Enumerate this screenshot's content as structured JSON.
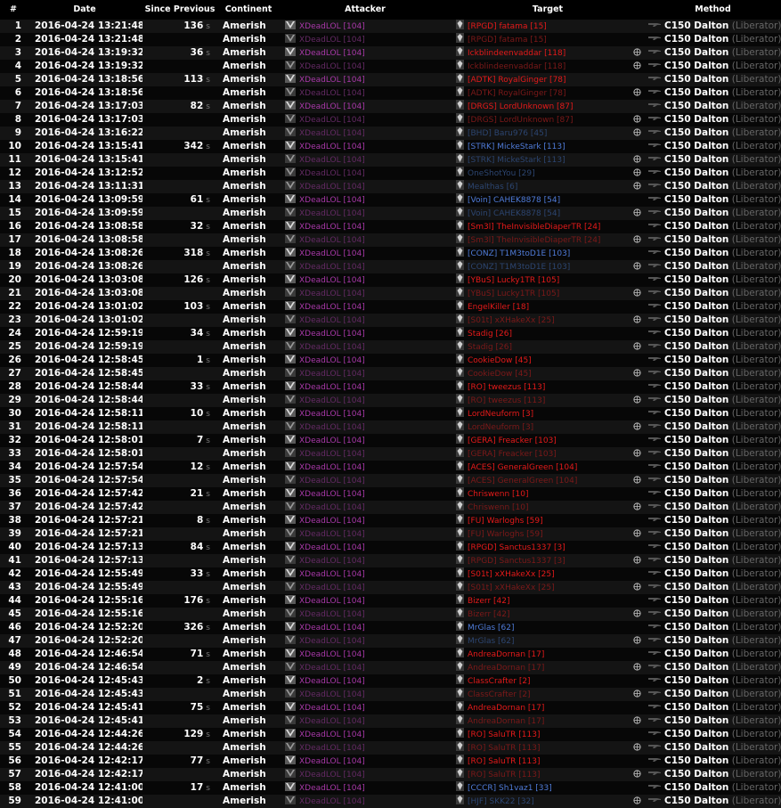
{
  "headers": {
    "num": "#",
    "date": "Date",
    "since": "Since Previous",
    "continent": "Continent",
    "attacker": "Attacker",
    "target": "Target",
    "method": "Method"
  },
  "colors": {
    "attacker_nc": "#a838a8",
    "vs_target": "#e51a1a",
    "nc_target": "#4f7bd8",
    "dim_vs": "#7c1919",
    "dim_nc": "#2c4570"
  },
  "icons": {
    "attacker_emblem": "vs-emblem-icon",
    "target_rank": "rank-icon",
    "headshot": "headshot-icon",
    "weapon": "weapon-icon"
  },
  "rows": [
    {
      "num": "1",
      "date": "2016-04-24 13:21:48",
      "since": "136",
      "continent": "Amerish",
      "attacker": "XDeadLOL [104]",
      "attacker_dim": false,
      "target": "[RPGD] fatama [15]",
      "tcolor": "red",
      "hs": false,
      "method": "C150 Dalton",
      "method_sub": "(Liberator)"
    },
    {
      "num": "2",
      "date": "2016-04-24 13:21:48",
      "since": "",
      "continent": "Amerish",
      "attacker": "XDeadLOL [104]",
      "attacker_dim": true,
      "target": "[RPGD] fatama [15]",
      "tcolor": "dred",
      "hs": false,
      "method": "C150 Dalton",
      "method_sub": "(Liberator)"
    },
    {
      "num": "3",
      "date": "2016-04-24 13:19:32",
      "since": "36",
      "continent": "Amerish",
      "attacker": "XDeadLOL [104]",
      "attacker_dim": false,
      "target": "Ickblindeenvaddar [118]",
      "tcolor": "red",
      "hs": true,
      "method": "C150 Dalton",
      "method_sub": "(Liberator)"
    },
    {
      "num": "4",
      "date": "2016-04-24 13:19:32",
      "since": "",
      "continent": "Amerish",
      "attacker": "XDeadLOL [104]",
      "attacker_dim": true,
      "target": "Ickblindeenvaddar [118]",
      "tcolor": "dred",
      "hs": true,
      "method": "C150 Dalton",
      "method_sub": "(Liberator)"
    },
    {
      "num": "5",
      "date": "2016-04-24 13:18:56",
      "since": "113",
      "continent": "Amerish",
      "attacker": "XDeadLOL [104]",
      "attacker_dim": false,
      "target": "[ADTK] RoyalGinger [78]",
      "tcolor": "red",
      "hs": false,
      "method": "C150 Dalton",
      "method_sub": "(Liberator)"
    },
    {
      "num": "6",
      "date": "2016-04-24 13:18:56",
      "since": "",
      "continent": "Amerish",
      "attacker": "XDeadLOL [104]",
      "attacker_dim": true,
      "target": "[ADTK] RoyalGinger [78]",
      "tcolor": "dred",
      "hs": true,
      "method": "C150 Dalton",
      "method_sub": "(Liberator)"
    },
    {
      "num": "7",
      "date": "2016-04-24 13:17:03",
      "since": "82",
      "continent": "Amerish",
      "attacker": "XDeadLOL [104]",
      "attacker_dim": false,
      "target": "[DRGS] LordUnknown [87]",
      "tcolor": "red",
      "hs": false,
      "method": "C150 Dalton",
      "method_sub": "(Liberator)"
    },
    {
      "num": "8",
      "date": "2016-04-24 13:17:03",
      "since": "",
      "continent": "Amerish",
      "attacker": "XDeadLOL [104]",
      "attacker_dim": true,
      "target": "[DRGS] LordUnknown [87]",
      "tcolor": "dred",
      "hs": true,
      "method": "C150 Dalton",
      "method_sub": "(Liberator)"
    },
    {
      "num": "9",
      "date": "2016-04-24 13:16:22",
      "since": "",
      "continent": "Amerish",
      "attacker": "XDeadLOL [104]",
      "attacker_dim": true,
      "target": "[BHD] Baru976 [45]",
      "tcolor": "dblue",
      "hs": true,
      "method": "C150 Dalton",
      "method_sub": "(Liberator)"
    },
    {
      "num": "10",
      "date": "2016-04-24 13:15:41",
      "since": "342",
      "continent": "Amerish",
      "attacker": "XDeadLOL [104]",
      "attacker_dim": false,
      "target": "[STRK] MickeStark [113]",
      "tcolor": "blue",
      "hs": false,
      "method": "C150 Dalton",
      "method_sub": "(Liberator)"
    },
    {
      "num": "11",
      "date": "2016-04-24 13:15:41",
      "since": "",
      "continent": "Amerish",
      "attacker": "XDeadLOL [104]",
      "attacker_dim": true,
      "target": "[STRK] MickeStark [113]",
      "tcolor": "dblue",
      "hs": true,
      "method": "C150 Dalton",
      "method_sub": "(Liberator)"
    },
    {
      "num": "12",
      "date": "2016-04-24 13:12:52",
      "since": "",
      "continent": "Amerish",
      "attacker": "XDeadLOL [104]",
      "attacker_dim": true,
      "target": "OneShotYou [29]",
      "tcolor": "dblue",
      "hs": true,
      "method": "C150 Dalton",
      "method_sub": "(Liberator)"
    },
    {
      "num": "13",
      "date": "2016-04-24 13:11:31",
      "since": "",
      "continent": "Amerish",
      "attacker": "XDeadLOL [104]",
      "attacker_dim": true,
      "target": "Mealthas [6]",
      "tcolor": "dblue",
      "hs": true,
      "method": "C150 Dalton",
      "method_sub": "(Liberator)"
    },
    {
      "num": "14",
      "date": "2016-04-24 13:09:59",
      "since": "61",
      "continent": "Amerish",
      "attacker": "XDeadLOL [104]",
      "attacker_dim": false,
      "target": "[Voin] CAHEK8878 [54]",
      "tcolor": "blue",
      "hs": false,
      "method": "C150 Dalton",
      "method_sub": "(Liberator)"
    },
    {
      "num": "15",
      "date": "2016-04-24 13:09:59",
      "since": "",
      "continent": "Amerish",
      "attacker": "XDeadLOL [104]",
      "attacker_dim": true,
      "target": "[Voin] CAHEK8878 [54]",
      "tcolor": "dblue",
      "hs": true,
      "method": "C150 Dalton",
      "method_sub": "(Liberator)"
    },
    {
      "num": "16",
      "date": "2016-04-24 13:08:58",
      "since": "32",
      "continent": "Amerish",
      "attacker": "XDeadLOL [104]",
      "attacker_dim": false,
      "target": "[Sm3l] TheInvisibleDiaperTR [24]",
      "tcolor": "red",
      "hs": false,
      "method": "C150 Dalton",
      "method_sub": "(Liberator)"
    },
    {
      "num": "17",
      "date": "2016-04-24 13:08:58",
      "since": "",
      "continent": "Amerish",
      "attacker": "XDeadLOL [104]",
      "attacker_dim": true,
      "target": "[Sm3l] TheInvisibleDiaperTR [24]",
      "tcolor": "dred",
      "hs": true,
      "method": "C150 Dalton",
      "method_sub": "(Liberator)"
    },
    {
      "num": "18",
      "date": "2016-04-24 13:08:26",
      "since": "318",
      "continent": "Amerish",
      "attacker": "XDeadLOL [104]",
      "attacker_dim": false,
      "target": "[CONZ] T1M3toD1E [103]",
      "tcolor": "blue",
      "hs": false,
      "method": "C150 Dalton",
      "method_sub": "(Liberator)"
    },
    {
      "num": "19",
      "date": "2016-04-24 13:08:26",
      "since": "",
      "continent": "Amerish",
      "attacker": "XDeadLOL [104]",
      "attacker_dim": true,
      "target": "[CONZ] T1M3toD1E [103]",
      "tcolor": "dblue",
      "hs": true,
      "method": "C150 Dalton",
      "method_sub": "(Liberator)"
    },
    {
      "num": "20",
      "date": "2016-04-24 13:03:08",
      "since": "126",
      "continent": "Amerish",
      "attacker": "XDeadLOL [104]",
      "attacker_dim": false,
      "target": "[YBuS] Lucky1TR [105]",
      "tcolor": "red",
      "hs": false,
      "method": "C150 Dalton",
      "method_sub": "(Liberator)"
    },
    {
      "num": "21",
      "date": "2016-04-24 13:03:08",
      "since": "",
      "continent": "Amerish",
      "attacker": "XDeadLOL [104]",
      "attacker_dim": true,
      "target": "[YBuS] Lucky1TR [105]",
      "tcolor": "dred",
      "hs": true,
      "method": "C150 Dalton",
      "method_sub": "(Liberator)"
    },
    {
      "num": "22",
      "date": "2016-04-24 13:01:02",
      "since": "103",
      "continent": "Amerish",
      "attacker": "XDeadLOL [104]",
      "attacker_dim": false,
      "target": "EngelKiller [18]",
      "tcolor": "red",
      "hs": false,
      "method": "C150 Dalton",
      "method_sub": "(Liberator)"
    },
    {
      "num": "23",
      "date": "2016-04-24 13:01:02",
      "since": "",
      "continent": "Amerish",
      "attacker": "XDeadLOL [104]",
      "attacker_dim": true,
      "target": "[S01t] xXHakeXx [25]",
      "tcolor": "dred",
      "hs": true,
      "method": "C150 Dalton",
      "method_sub": "(Liberator)"
    },
    {
      "num": "24",
      "date": "2016-04-24 12:59:19",
      "since": "34",
      "continent": "Amerish",
      "attacker": "XDeadLOL [104]",
      "attacker_dim": false,
      "target": "Stadig [26]",
      "tcolor": "red",
      "hs": false,
      "method": "C150 Dalton",
      "method_sub": "(Liberator)"
    },
    {
      "num": "25",
      "date": "2016-04-24 12:59:19",
      "since": "",
      "continent": "Amerish",
      "attacker": "XDeadLOL [104]",
      "attacker_dim": true,
      "target": "Stadig [26]",
      "tcolor": "dred",
      "hs": true,
      "method": "C150 Dalton",
      "method_sub": "(Liberator)"
    },
    {
      "num": "26",
      "date": "2016-04-24 12:58:45",
      "since": "1",
      "continent": "Amerish",
      "attacker": "XDeadLOL [104]",
      "attacker_dim": false,
      "target": "CookieDow [45]",
      "tcolor": "red",
      "hs": false,
      "method": "C150 Dalton",
      "method_sub": "(Liberator)"
    },
    {
      "num": "27",
      "date": "2016-04-24 12:58:45",
      "since": "",
      "continent": "Amerish",
      "attacker": "XDeadLOL [104]",
      "attacker_dim": true,
      "target": "CookieDow [45]",
      "tcolor": "dred",
      "hs": true,
      "method": "C150 Dalton",
      "method_sub": "(Liberator)"
    },
    {
      "num": "28",
      "date": "2016-04-24 12:58:44",
      "since": "33",
      "continent": "Amerish",
      "attacker": "XDeadLOL [104]",
      "attacker_dim": false,
      "target": "[RO] tweezus [113]",
      "tcolor": "red",
      "hs": false,
      "method": "C150 Dalton",
      "method_sub": "(Liberator)"
    },
    {
      "num": "29",
      "date": "2016-04-24 12:58:44",
      "since": "",
      "continent": "Amerish",
      "attacker": "XDeadLOL [104]",
      "attacker_dim": true,
      "target": "[RO] tweezus [113]",
      "tcolor": "dred",
      "hs": true,
      "method": "C150 Dalton",
      "method_sub": "(Liberator)"
    },
    {
      "num": "30",
      "date": "2016-04-24 12:58:11",
      "since": "10",
      "continent": "Amerish",
      "attacker": "XDeadLOL [104]",
      "attacker_dim": false,
      "target": "LordNeuform [3]",
      "tcolor": "red",
      "hs": false,
      "method": "C150 Dalton",
      "method_sub": "(Liberator)"
    },
    {
      "num": "31",
      "date": "2016-04-24 12:58:11",
      "since": "",
      "continent": "Amerish",
      "attacker": "XDeadLOL [104]",
      "attacker_dim": true,
      "target": "LordNeuform [3]",
      "tcolor": "dred",
      "hs": true,
      "method": "C150 Dalton",
      "method_sub": "(Liberator)"
    },
    {
      "num": "32",
      "date": "2016-04-24 12:58:01",
      "since": "7",
      "continent": "Amerish",
      "attacker": "XDeadLOL [104]",
      "attacker_dim": false,
      "target": "[GERA] Freacker [103]",
      "tcolor": "red",
      "hs": false,
      "method": "C150 Dalton",
      "method_sub": "(Liberator)"
    },
    {
      "num": "33",
      "date": "2016-04-24 12:58:01",
      "since": "",
      "continent": "Amerish",
      "attacker": "XDeadLOL [104]",
      "attacker_dim": true,
      "target": "[GERA] Freacker [103]",
      "tcolor": "dred",
      "hs": true,
      "method": "C150 Dalton",
      "method_sub": "(Liberator)"
    },
    {
      "num": "34",
      "date": "2016-04-24 12:57:54",
      "since": "12",
      "continent": "Amerish",
      "attacker": "XDeadLOL [104]",
      "attacker_dim": false,
      "target": "[ACES] GeneralGreen [104]",
      "tcolor": "red",
      "hs": false,
      "method": "C150 Dalton",
      "method_sub": "(Liberator)"
    },
    {
      "num": "35",
      "date": "2016-04-24 12:57:54",
      "since": "",
      "continent": "Amerish",
      "attacker": "XDeadLOL [104]",
      "attacker_dim": true,
      "target": "[ACES] GeneralGreen [104]",
      "tcolor": "dred",
      "hs": true,
      "method": "C150 Dalton",
      "method_sub": "(Liberator)"
    },
    {
      "num": "36",
      "date": "2016-04-24 12:57:42",
      "since": "21",
      "continent": "Amerish",
      "attacker": "XDeadLOL [104]",
      "attacker_dim": false,
      "target": "Chriswenn [10]",
      "tcolor": "red",
      "hs": false,
      "method": "C150 Dalton",
      "method_sub": "(Liberator)"
    },
    {
      "num": "37",
      "date": "2016-04-24 12:57:42",
      "since": "",
      "continent": "Amerish",
      "attacker": "XDeadLOL [104]",
      "attacker_dim": true,
      "target": "Chriswenn [10]",
      "tcolor": "dred",
      "hs": true,
      "method": "C150 Dalton",
      "method_sub": "(Liberator)"
    },
    {
      "num": "38",
      "date": "2016-04-24 12:57:21",
      "since": "8",
      "continent": "Amerish",
      "attacker": "XDeadLOL [104]",
      "attacker_dim": false,
      "target": "[FU] Warloghs [59]",
      "tcolor": "red",
      "hs": false,
      "method": "C150 Dalton",
      "method_sub": "(Liberator)"
    },
    {
      "num": "39",
      "date": "2016-04-24 12:57:21",
      "since": "",
      "continent": "Amerish",
      "attacker": "XDeadLOL [104]",
      "attacker_dim": true,
      "target": "[FU] Warloghs [59]",
      "tcolor": "dred",
      "hs": true,
      "method": "C150 Dalton",
      "method_sub": "(Liberator)"
    },
    {
      "num": "40",
      "date": "2016-04-24 12:57:13",
      "since": "84",
      "continent": "Amerish",
      "attacker": "XDeadLOL [104]",
      "attacker_dim": false,
      "target": "[RPGD] Sanctus1337 [3]",
      "tcolor": "red",
      "hs": false,
      "method": "C150 Dalton",
      "method_sub": "(Liberator)"
    },
    {
      "num": "41",
      "date": "2016-04-24 12:57:13",
      "since": "",
      "continent": "Amerish",
      "attacker": "XDeadLOL [104]",
      "attacker_dim": true,
      "target": "[RPGD] Sanctus1337 [3]",
      "tcolor": "dred",
      "hs": true,
      "method": "C150 Dalton",
      "method_sub": "(Liberator)"
    },
    {
      "num": "42",
      "date": "2016-04-24 12:55:49",
      "since": "33",
      "continent": "Amerish",
      "attacker": "XDeadLOL [104]",
      "attacker_dim": false,
      "target": "[S01t] xXHakeXx [25]",
      "tcolor": "red",
      "hs": false,
      "method": "C150 Dalton",
      "method_sub": "(Liberator)"
    },
    {
      "num": "43",
      "date": "2016-04-24 12:55:49",
      "since": "",
      "continent": "Amerish",
      "attacker": "XDeadLOL [104]",
      "attacker_dim": true,
      "target": "[S01t] xXHakeXx [25]",
      "tcolor": "dred",
      "hs": true,
      "method": "C150 Dalton",
      "method_sub": "(Liberator)"
    },
    {
      "num": "44",
      "date": "2016-04-24 12:55:16",
      "since": "176",
      "continent": "Amerish",
      "attacker": "XDeadLOL [104]",
      "attacker_dim": false,
      "target": "Bizerr [42]",
      "tcolor": "red",
      "hs": false,
      "method": "C150 Dalton",
      "method_sub": "(Liberator)"
    },
    {
      "num": "45",
      "date": "2016-04-24 12:55:16",
      "since": "",
      "continent": "Amerish",
      "attacker": "XDeadLOL [104]",
      "attacker_dim": true,
      "target": "Bizerr [42]",
      "tcolor": "dred",
      "hs": true,
      "method": "C150 Dalton",
      "method_sub": "(Liberator)"
    },
    {
      "num": "46",
      "date": "2016-04-24 12:52:20",
      "since": "326",
      "continent": "Amerish",
      "attacker": "XDeadLOL [104]",
      "attacker_dim": false,
      "target": "MrGlas [62]",
      "tcolor": "blue",
      "hs": false,
      "method": "C150 Dalton",
      "method_sub": "(Liberator)"
    },
    {
      "num": "47",
      "date": "2016-04-24 12:52:20",
      "since": "",
      "continent": "Amerish",
      "attacker": "XDeadLOL [104]",
      "attacker_dim": true,
      "target": "MrGlas [62]",
      "tcolor": "dblue",
      "hs": true,
      "method": "C150 Dalton",
      "method_sub": "(Liberator)"
    },
    {
      "num": "48",
      "date": "2016-04-24 12:46:54",
      "since": "71",
      "continent": "Amerish",
      "attacker": "XDeadLOL [104]",
      "attacker_dim": false,
      "target": "AndreaDornan [17]",
      "tcolor": "red",
      "hs": false,
      "method": "C150 Dalton",
      "method_sub": "(Liberator)"
    },
    {
      "num": "49",
      "date": "2016-04-24 12:46:54",
      "since": "",
      "continent": "Amerish",
      "attacker": "XDeadLOL [104]",
      "attacker_dim": true,
      "target": "AndreaDornan [17]",
      "tcolor": "dred",
      "hs": true,
      "method": "C150 Dalton",
      "method_sub": "(Liberator)"
    },
    {
      "num": "50",
      "date": "2016-04-24 12:45:43",
      "since": "2",
      "continent": "Amerish",
      "attacker": "XDeadLOL [104]",
      "attacker_dim": false,
      "target": "ClassCrafter [2]",
      "tcolor": "red",
      "hs": false,
      "method": "C150 Dalton",
      "method_sub": "(Liberator)"
    },
    {
      "num": "51",
      "date": "2016-04-24 12:45:43",
      "since": "",
      "continent": "Amerish",
      "attacker": "XDeadLOL [104]",
      "attacker_dim": true,
      "target": "ClassCrafter [2]",
      "tcolor": "dred",
      "hs": true,
      "method": "C150 Dalton",
      "method_sub": "(Liberator)"
    },
    {
      "num": "52",
      "date": "2016-04-24 12:45:41",
      "since": "75",
      "continent": "Amerish",
      "attacker": "XDeadLOL [104]",
      "attacker_dim": false,
      "target": "AndreaDornan [17]",
      "tcolor": "red",
      "hs": false,
      "method": "C150 Dalton",
      "method_sub": "(Liberator)"
    },
    {
      "num": "53",
      "date": "2016-04-24 12:45:41",
      "since": "",
      "continent": "Amerish",
      "attacker": "XDeadLOL [104]",
      "attacker_dim": true,
      "target": "AndreaDornan [17]",
      "tcolor": "dred",
      "hs": true,
      "method": "C150 Dalton",
      "method_sub": "(Liberator)"
    },
    {
      "num": "54",
      "date": "2016-04-24 12:44:26",
      "since": "129",
      "continent": "Amerish",
      "attacker": "XDeadLOL [104]",
      "attacker_dim": false,
      "target": "[RO] SaluTR [113]",
      "tcolor": "red",
      "hs": false,
      "method": "C150 Dalton",
      "method_sub": "(Liberator)"
    },
    {
      "num": "55",
      "date": "2016-04-24 12:44:26",
      "since": "",
      "continent": "Amerish",
      "attacker": "XDeadLOL [104]",
      "attacker_dim": true,
      "target": "[RO] SaluTR [113]",
      "tcolor": "dred",
      "hs": true,
      "method": "C150 Dalton",
      "method_sub": "(Liberator)"
    },
    {
      "num": "56",
      "date": "2016-04-24 12:42:17",
      "since": "77",
      "continent": "Amerish",
      "attacker": "XDeadLOL [104]",
      "attacker_dim": false,
      "target": "[RO] SaluTR [113]",
      "tcolor": "red",
      "hs": false,
      "method": "C150 Dalton",
      "method_sub": "(Liberator)"
    },
    {
      "num": "57",
      "date": "2016-04-24 12:42:17",
      "since": "",
      "continent": "Amerish",
      "attacker": "XDeadLOL [104]",
      "attacker_dim": true,
      "target": "[RO] SaluTR [113]",
      "tcolor": "dred",
      "hs": true,
      "method": "C150 Dalton",
      "method_sub": "(Liberator)"
    },
    {
      "num": "58",
      "date": "2016-04-24 12:41:00",
      "since": "17",
      "continent": "Amerish",
      "attacker": "XDeadLOL [104]",
      "attacker_dim": false,
      "target": "[CCCR] Sh1vaz1 [33]",
      "tcolor": "blue",
      "hs": false,
      "method": "C150 Dalton",
      "method_sub": "(Liberator)"
    },
    {
      "num": "59",
      "date": "2016-04-24 12:41:00",
      "since": "",
      "continent": "Amerish",
      "attacker": "XDeadLOL [104]",
      "attacker_dim": true,
      "target": "[HJF] SKK22 [32]",
      "tcolor": "dblue",
      "hs": true,
      "method": "C150 Dalton",
      "method_sub": "(Liberator)"
    }
  ],
  "since_unit": "s"
}
